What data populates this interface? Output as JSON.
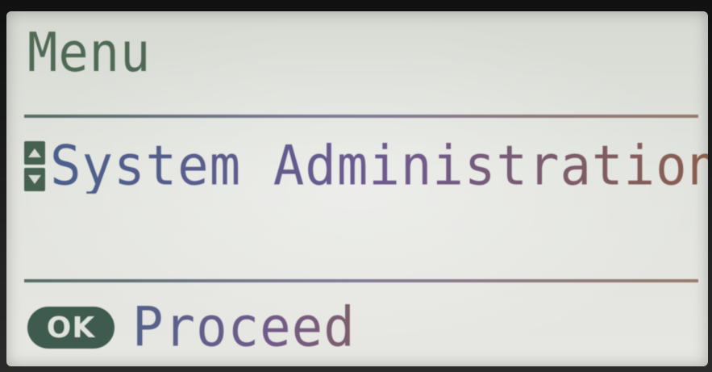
{
  "screen": {
    "title": "Menu",
    "selected_item": "System Administration",
    "scroll_indicator": "up-down-scroll-icon",
    "footer": {
      "button_label": "OK",
      "action_label": "Proceed"
    }
  },
  "colors": {
    "lcd_background": "#e0e2dd",
    "title_text": "#4f6a54",
    "item_text": "#5a5e8c",
    "ok_badge": "#3f5a4e"
  }
}
